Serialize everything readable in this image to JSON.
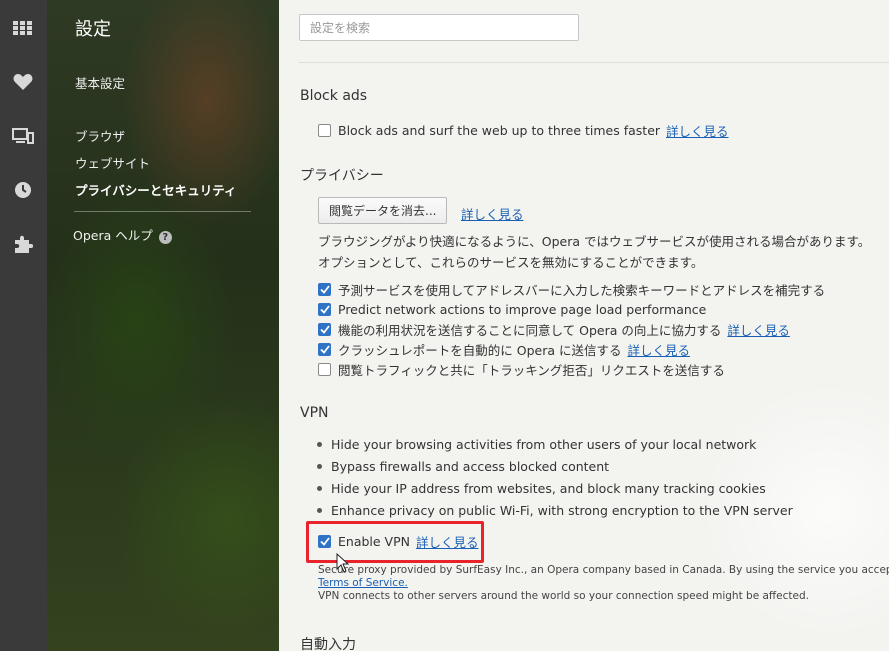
{
  "rail": {
    "icons": [
      "apps-grid-icon",
      "heart-icon",
      "devices-icon",
      "clock-icon",
      "puzzle-icon"
    ]
  },
  "sidebar": {
    "title": "設定",
    "basic": "基本設定",
    "browser": "ブラウザ",
    "websites": "ウェブサイト",
    "privacy": "プライバシーとセキュリティ",
    "help": "Opera ヘルプ",
    "help_icon": "?"
  },
  "search": {
    "placeholder": "設定を検索"
  },
  "blockads": {
    "heading": "Block ads",
    "checkbox_label": "Block ads and surf the web up to three times faster",
    "checked": false,
    "link": "詳しく見る"
  },
  "privacy": {
    "heading": "プライバシー",
    "clear_button": "閲覧データを消去...",
    "clear_link": "詳しく見る",
    "description": "ブラウジングがより快適になるように、Opera ではウェブサービスが使用される場合があります。 オプションとして、これらのサービスを無効にすることができます。",
    "options": [
      {
        "label": "予測サービスを使用してアドレスバーに入力した検索キーワードとアドレスを補完する",
        "checked": true,
        "link": ""
      },
      {
        "label": "Predict network actions to improve page load performance",
        "checked": true,
        "link": ""
      },
      {
        "label": "機能の利用状況を送信することに同意して Opera の向上に協力する",
        "checked": true,
        "link": "詳しく見る"
      },
      {
        "label": "クラッシュレポートを自動的に Opera に送信する",
        "checked": true,
        "link": "詳しく見る"
      },
      {
        "label": "閲覧トラフィックと共に「トラッキング拒否」リクエストを送信する",
        "checked": false,
        "link": ""
      }
    ]
  },
  "vpn": {
    "heading": "VPN",
    "bullets": [
      "Hide your browsing activities from other users of your local network",
      "Bypass firewalls and access blocked content",
      "Hide your IP address from websites, and block many tracking cookies",
      "Enhance privacy on public Wi-Fi, with strong encryption to the VPN server"
    ],
    "enable_label": "Enable VPN",
    "enable_checked": true,
    "enable_link": "詳しく見る",
    "note_line1": "Secure proxy provided by SurfEasy Inc., an Opera company based in Canada. By using the service you accept the",
    "terms_link": "Terms of Service.",
    "note_line2": "VPN connects to other servers around the world so your connection speed might be affected."
  },
  "autofill": {
    "heading": "自動入力"
  },
  "colors": {
    "accent": "#2e73c5",
    "link": "#1a5fb4",
    "highlight": "#e8232b"
  }
}
